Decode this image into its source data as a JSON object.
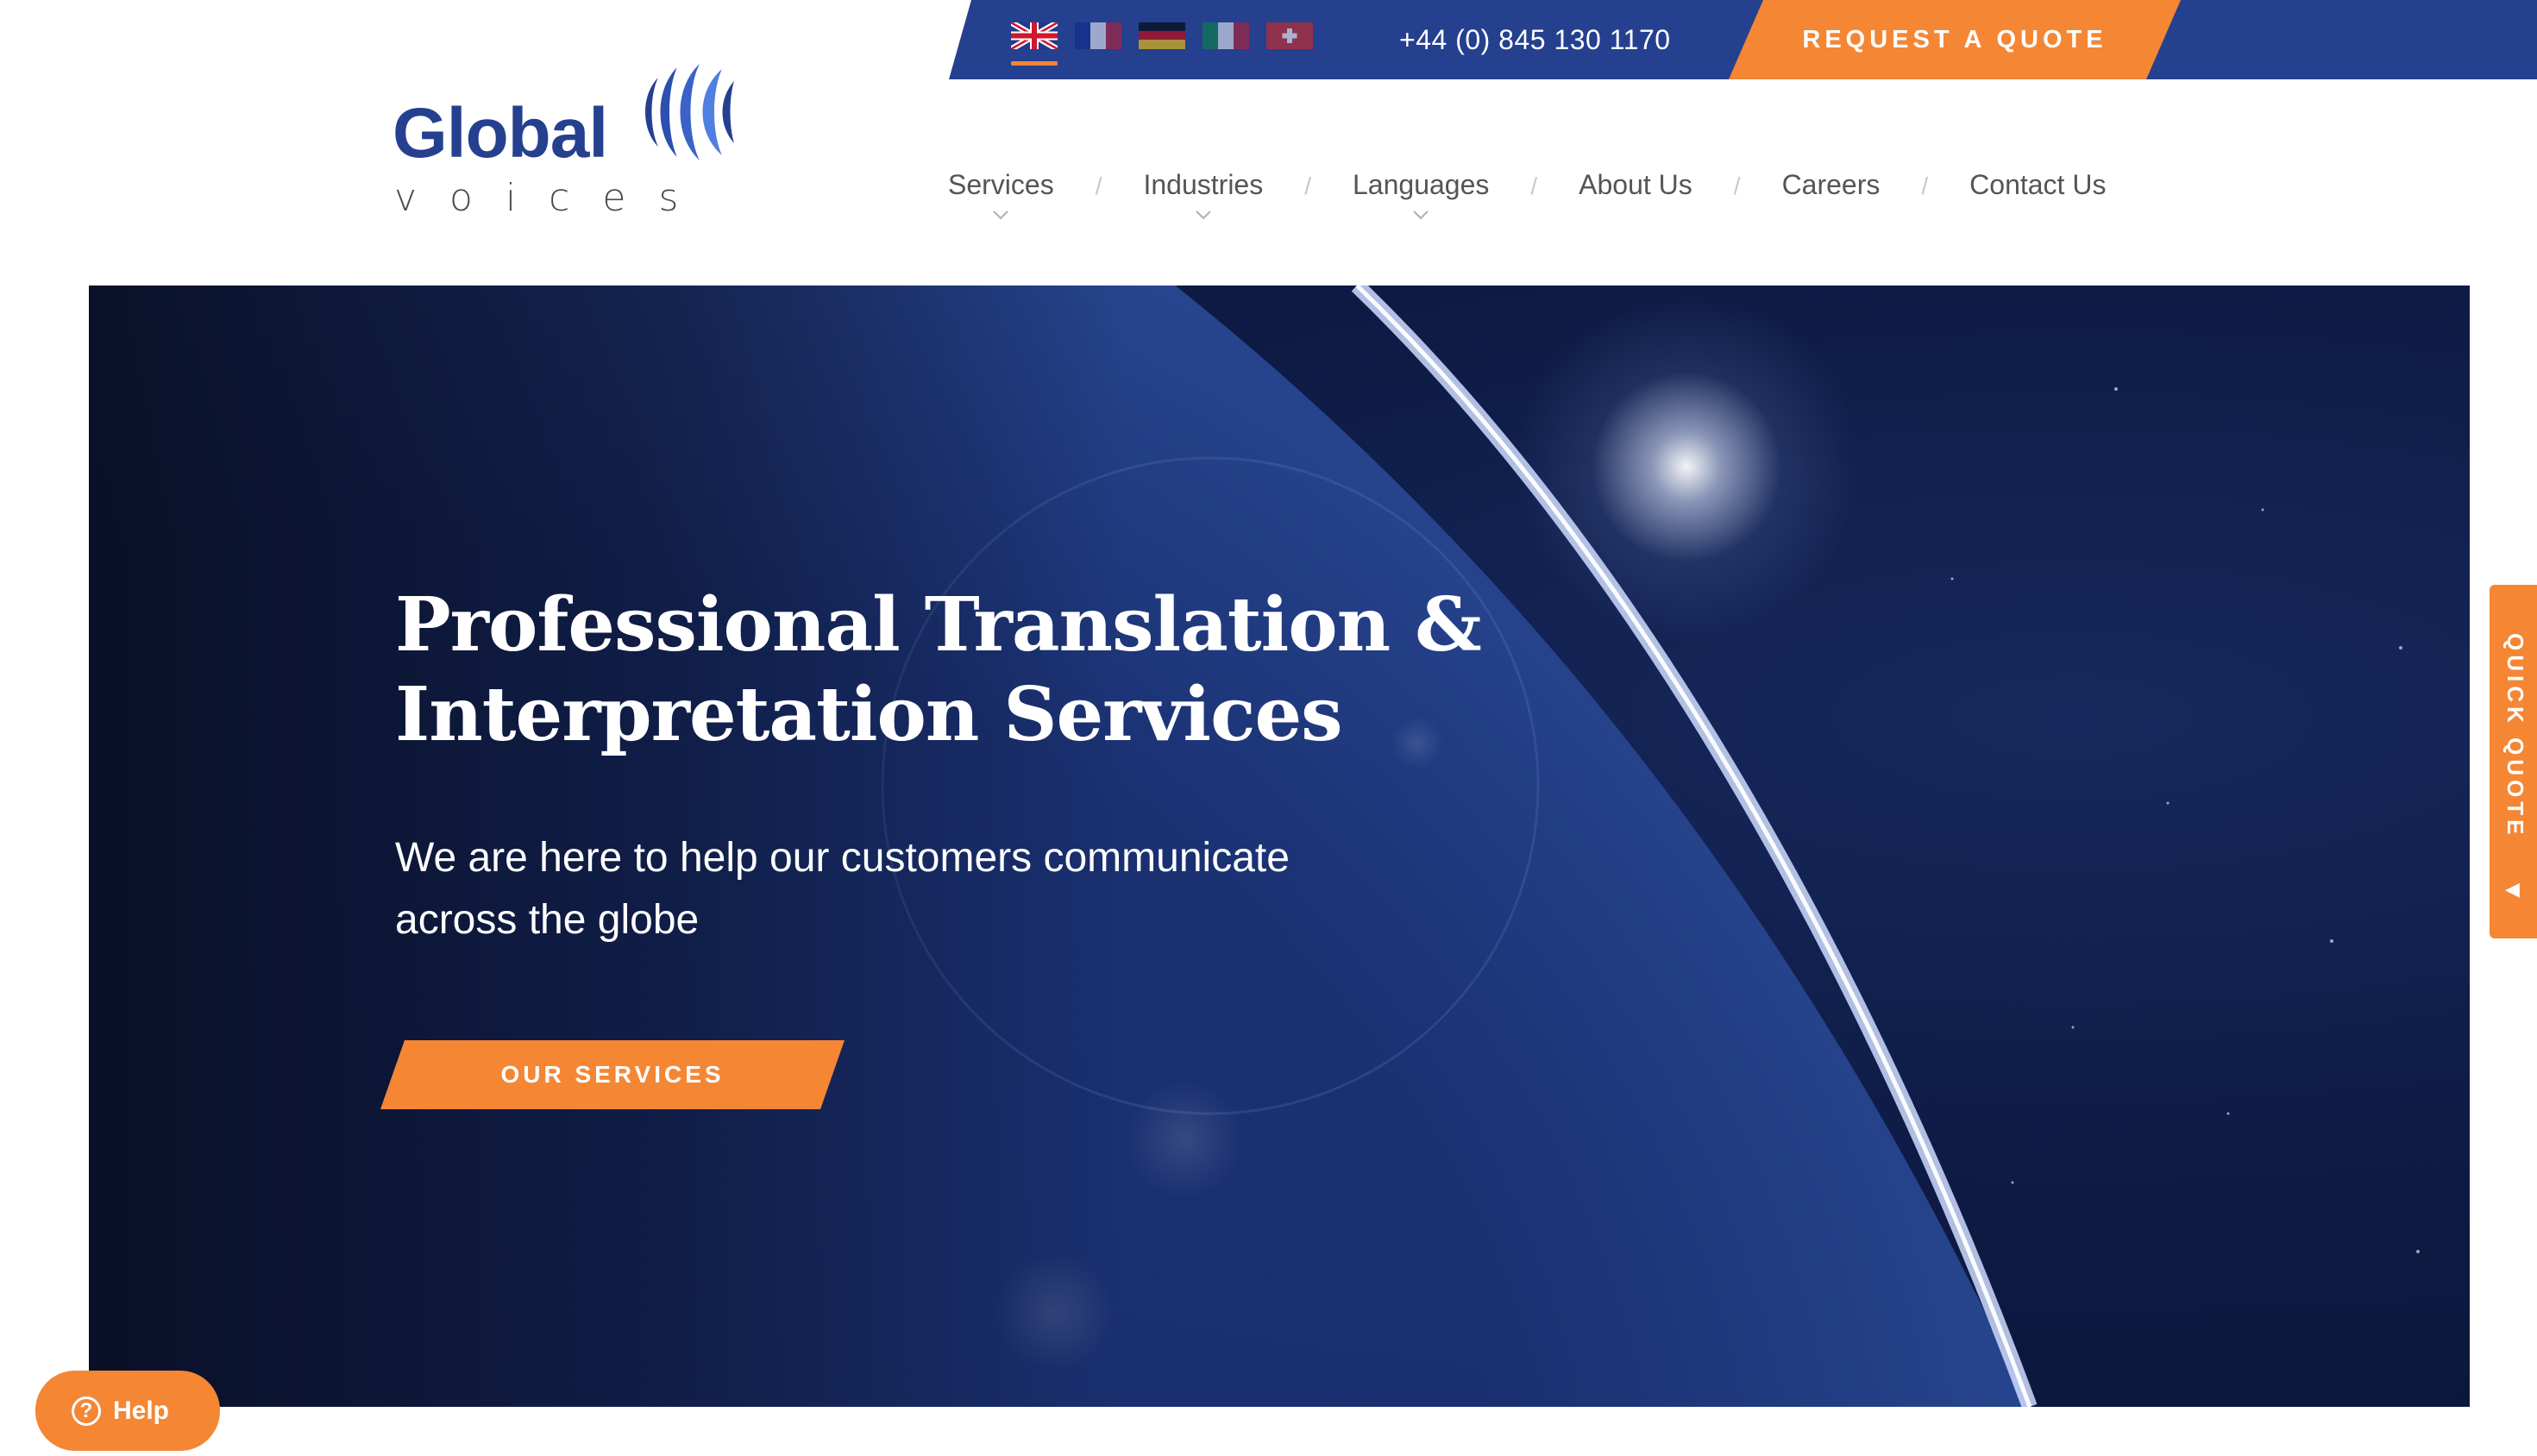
{
  "colors": {
    "brand_blue": "#25408f",
    "accent_orange": "#f58634",
    "hero_bg": "#0e1b45"
  },
  "topbar": {
    "flags": [
      {
        "name": "uk-flag-icon",
        "active": true
      },
      {
        "name": "france-flag-icon",
        "active": false
      },
      {
        "name": "germany-flag-icon",
        "active": false
      },
      {
        "name": "italy-flag-icon",
        "active": false
      },
      {
        "name": "switzerland-flag-icon",
        "active": false
      }
    ],
    "phone": "+44 (0) 845 130 1170",
    "quote_label": "REQUEST A QUOTE"
  },
  "logo": {
    "word1": "Global",
    "word2": "voices"
  },
  "nav": {
    "items": [
      {
        "label": "Services",
        "dropdown": true
      },
      {
        "label": "Industries",
        "dropdown": true
      },
      {
        "label": "Languages",
        "dropdown": true
      },
      {
        "label": "About Us",
        "dropdown": false
      },
      {
        "label": "Careers",
        "dropdown": false
      },
      {
        "label": "Contact Us",
        "dropdown": false
      }
    ],
    "separator": "/"
  },
  "hero": {
    "title_line1": "Professional Translation &",
    "title_line2": "Interpretation Services",
    "subtitle_line1": "We are here to help our customers communicate",
    "subtitle_line2": "across the globe",
    "button_label": "OUR SERVICES"
  },
  "quick_quote": {
    "label": "QUICK QUOTE",
    "arrow": "◀"
  },
  "help": {
    "icon": "?",
    "label": "Help"
  }
}
